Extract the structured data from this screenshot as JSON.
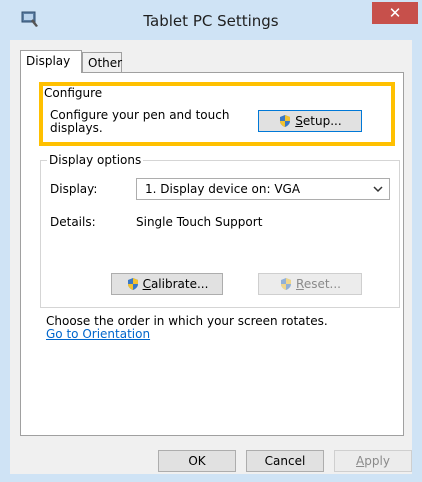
{
  "window": {
    "title": "Tablet PC Settings",
    "close_label": "✕"
  },
  "tabs": [
    {
      "label": "Display"
    },
    {
      "label": "Other"
    }
  ],
  "configure": {
    "group_label": "Configure",
    "description_line1": "Configure your pen and touch",
    "description_line2": "displays.",
    "setup_button": {
      "prefix": "",
      "mnemonic": "S",
      "rest": "etup..."
    }
  },
  "display_options": {
    "group_label": "Display options",
    "display_label": "Display:",
    "display_value": "1. Display device on: VGA",
    "details_label": "Details:",
    "details_value": "Single Touch Support",
    "calibrate_button": {
      "mnemonic": "C",
      "rest": "alibrate..."
    },
    "reset_button": {
      "mnemonic": "R",
      "rest": "eset..."
    }
  },
  "orientation": {
    "text": "Choose the order in which your screen rotates.",
    "link": "Go to Orientation"
  },
  "footer": {
    "ok": "OK",
    "cancel": "Cancel",
    "apply_mnemonic": "A",
    "apply_rest": "pply"
  },
  "colors": {
    "accent": "#0078d7",
    "highlight": "#ffc000",
    "close": "#c7504b",
    "link": "#0066cc",
    "frame": "#cfe3f5"
  }
}
